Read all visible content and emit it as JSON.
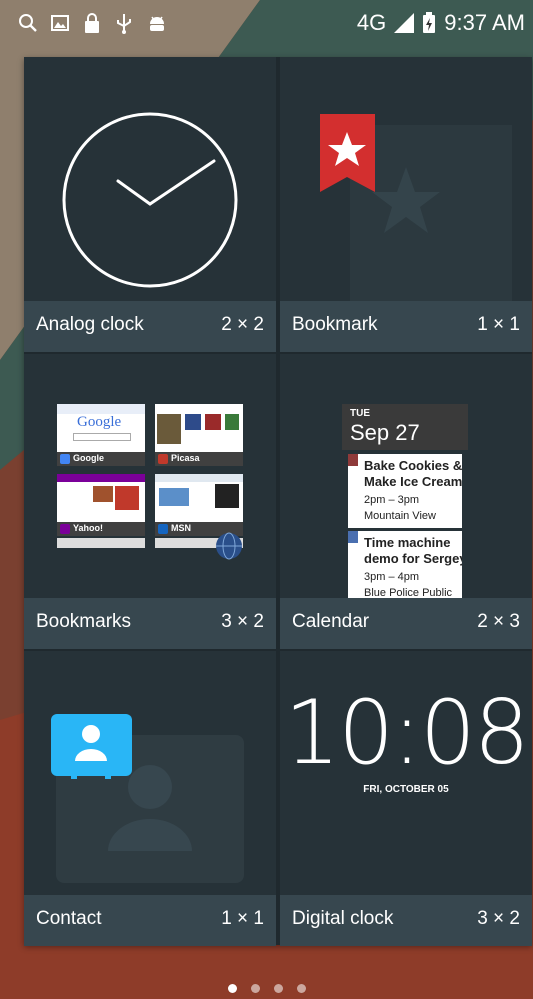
{
  "status_bar": {
    "left_icons": [
      "search-icon",
      "image-icon",
      "lock-icon",
      "usb-icon",
      "android-icon"
    ],
    "network": "4G",
    "time": "9:37 AM"
  },
  "widgets": [
    {
      "name": "Analog clock",
      "size": "2 × 2"
    },
    {
      "name": "Bookmark",
      "size": "1 × 1"
    },
    {
      "name": "Bookmarks",
      "size": "3 × 2"
    },
    {
      "name": "Calendar",
      "size": "2 × 3"
    },
    {
      "name": "Contact",
      "size": "1 × 1"
    },
    {
      "name": "Digital clock",
      "size": "3 × 2"
    }
  ],
  "bookmarks_preview": {
    "items": [
      "Google",
      "Picasa",
      "Yahoo!",
      "MSN"
    ],
    "google_logo": "Google"
  },
  "calendar_preview": {
    "day": "TUE",
    "date": "Sep 27",
    "events": [
      {
        "title_line1": "Bake Cookies &",
        "title_line2": "Make Ice Cream",
        "time": "2pm – 3pm",
        "place": "Mountain View"
      },
      {
        "title_line1": "Time machine",
        "title_line2": "demo for Sergey",
        "time": "3pm – 4pm",
        "place": "Blue Police Public"
      }
    ]
  },
  "digital_clock_preview": {
    "time": "10:08",
    "date": "FRI, OCTOBER 05"
  },
  "page_indicator": {
    "count": 4,
    "active_index": 0
  },
  "colors": {
    "panel": "#263238",
    "footer": "#37474f",
    "bookmark_red": "#d32f2f",
    "contact_blue": "#29b6f6"
  }
}
